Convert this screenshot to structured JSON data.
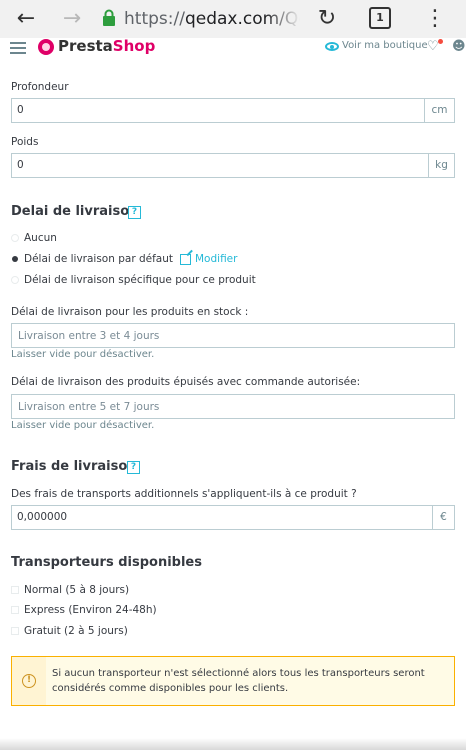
{
  "browser": {
    "url_scheme": "https://",
    "url_host": "qedax.com/Qe",
    "tab_count": "1",
    "back_icon": "arrow-left-icon",
    "forward_icon": "arrow-right-icon",
    "lock_icon": "lock-icon",
    "reload_icon": "reload-icon",
    "menu_icon": "kebab-menu-icon"
  },
  "header": {
    "logo_part1": "Presta",
    "logo_part2": "Shop",
    "view_shop": "Voir ma boutique"
  },
  "dimensions": {
    "depth_label": "Profondeur",
    "depth_value": "0",
    "depth_unit": "cm",
    "weight_label": "Poids",
    "weight_value": "0",
    "weight_unit": "kg"
  },
  "delivery_time": {
    "title": "Delai de livraison",
    "help": "?",
    "options": [
      {
        "label": "Aucun",
        "checked": false
      },
      {
        "label": "Délai de livraison par défaut",
        "checked": true
      },
      {
        "label": "Délai de livraison spécifique pour ce produit",
        "checked": false
      }
    ],
    "modify_link": "Modifier",
    "in_stock_label": "Délai de livraison pour les produits en stock :",
    "in_stock_placeholder": "Livraison entre 3 et 4 jours",
    "in_stock_help": "Laisser vide pour désactiver.",
    "out_of_stock_label": "Délai de livraison des produits épuisés avec commande autorisée:",
    "out_of_stock_placeholder": "Livraison entre 5 et 7 jours",
    "out_of_stock_help": "Laisser vide pour désactiver."
  },
  "shipping_fees": {
    "title": "Frais de livraison",
    "help": "?",
    "question": "Des frais de transports additionnels s'appliquent-ils à ce produit ?",
    "value": "0,000000",
    "currency": "€"
  },
  "carriers": {
    "title": "Transporteurs disponibles",
    "items": [
      {
        "label": "Normal (5 à 8 jours)",
        "checked": false
      },
      {
        "label": "Express (Environ 24-48h)",
        "checked": false
      },
      {
        "label": "Gratuit (2 à 5 jours)",
        "checked": false
      }
    ]
  },
  "warning": {
    "icon": "!",
    "text": "Si aucun transporteur n'est sélectionné alors tous les transporteurs seront considérés comme disponibles pour les clients."
  }
}
